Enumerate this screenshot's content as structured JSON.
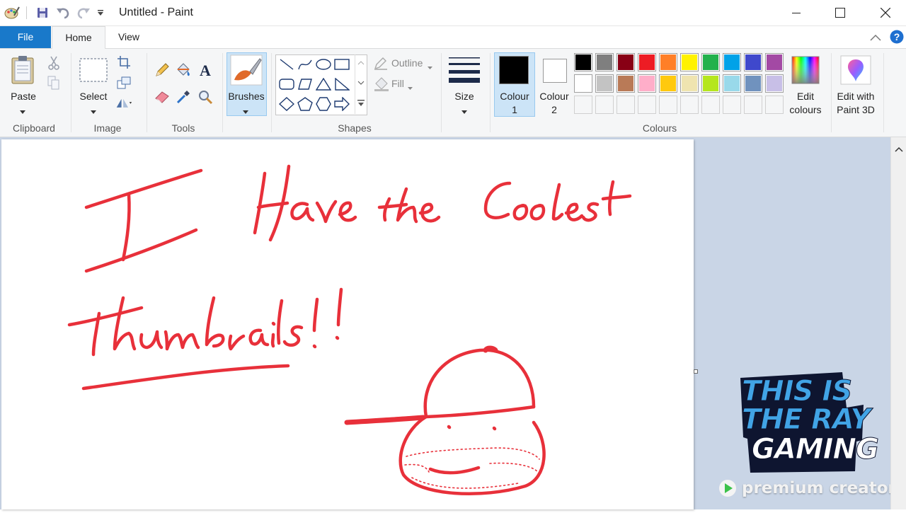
{
  "window": {
    "title": "Untitled - Paint"
  },
  "menu": {
    "file": "File",
    "home": "Home",
    "view": "View"
  },
  "ribbon": {
    "clipboard": {
      "paste": "Paste",
      "group": "Clipboard"
    },
    "image": {
      "select": "Select",
      "group": "Image"
    },
    "tools": {
      "group": "Tools"
    },
    "brushes": {
      "label": "Brushes"
    },
    "shapes": {
      "outline": "Outline",
      "fill": "Fill",
      "group": "Shapes"
    },
    "size": {
      "label": "Size"
    },
    "colours": {
      "colour1_line1": "Colour",
      "colour1_line2": "1",
      "colour2_line1": "Colour",
      "colour2_line2": "2",
      "edit_line1": "Edit",
      "edit_line2": "colours",
      "group": "Colours",
      "colour1_value": "#000000",
      "colour2_value": "#ffffff",
      "palette_row1": [
        "#000000",
        "#7f7f7f",
        "#880015",
        "#ed1c24",
        "#ff7f27",
        "#fff200",
        "#22b14c",
        "#00a2e8",
        "#3f48cc",
        "#a349a4"
      ],
      "palette_row2": [
        "#ffffff",
        "#c3c3c3",
        "#b97a57",
        "#ffaec9",
        "#ffc90e",
        "#efe4b0",
        "#b5e61d",
        "#99d9ea",
        "#7092be",
        "#c8bfe7"
      ]
    },
    "paint3d": {
      "line1": "Edit with",
      "line2": "Paint 3D"
    }
  },
  "canvas": {
    "handwriting_line1": "I Have the Coolest",
    "handwriting_line2": "Thumbnails!!",
    "ink_color": "#e8303a"
  },
  "watermark": {
    "line1": "THIS IS",
    "line2": "THE RAY",
    "line3": "GAMING",
    "badge": "premium creator"
  }
}
